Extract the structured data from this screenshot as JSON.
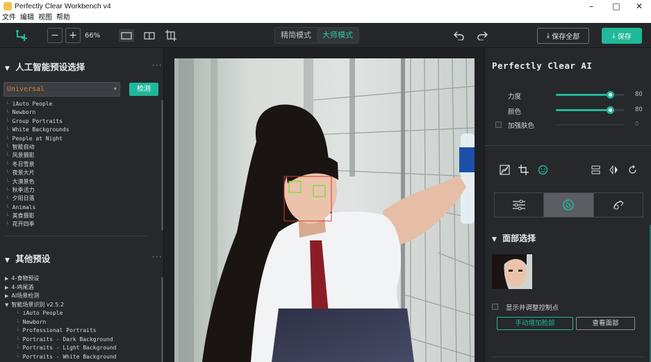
{
  "window": {
    "title": "Perfectly Clear Workbench v4",
    "minimize": "–",
    "maximize": "□",
    "close": "✕"
  },
  "menu": [
    "文件",
    "编辑",
    "视图",
    "帮助"
  ],
  "toolbar": {
    "zoom_out": "−",
    "zoom_in": "+",
    "zoom_level": "66%",
    "mode_simple": "精简模式",
    "mode_master": "大师模式",
    "save_all": "保存全部",
    "save": "保存"
  },
  "left": {
    "ai_section_title": "人工智能预设选择",
    "more_dots": "···",
    "preset_value": "Universal",
    "detect_button": "检测",
    "ai_presets": [
      "iAuto People",
      "Newborn",
      "Group Portraits",
      "White Backgrounds",
      "People at Night",
      "智能自动",
      "风景摄影",
      "冬日雪景",
      "夜景大片",
      "大漠景色",
      "秋季活力",
      "夕阳日落",
      "Animals",
      "美食摄影",
      "花开四季"
    ],
    "other_section_title": "其他预设",
    "other_presets": [
      {
        "arrow": "▶",
        "label": "4-食物预设"
      },
      {
        "arrow": "▶",
        "label": "4-鸡尾酒"
      },
      {
        "arrow": "▶",
        "label": "AI场景检测"
      },
      {
        "arrow": "▼",
        "label": "智能场景识别 v2.5.2"
      }
    ],
    "scene_children": [
      "iAuto People",
      "Newborn",
      "Professional Portraits",
      "Portraits - Dark Background",
      "Portraits - Light Background",
      "Portraits - White Background"
    ]
  },
  "right": {
    "title": "Perfectly Clear AI",
    "sliders": [
      {
        "label": "力度",
        "value": 80,
        "max": 100
      },
      {
        "label": "颜色",
        "value": 80,
        "max": 100
      }
    ],
    "skin_label": "加强肤色",
    "skin_value": 0,
    "face_section_title": "面部选择",
    "show_controls_label": "显示并调整控制点",
    "add_face_button": "手动增加脸部",
    "view_face_button": "查看面部"
  },
  "colors": {
    "accent": "#1fb89a",
    "preset_text": "#e07a30",
    "panel": "#26282c",
    "face_box_outer": "#d23a2a",
    "face_box_eye": "#7fdc3c"
  }
}
